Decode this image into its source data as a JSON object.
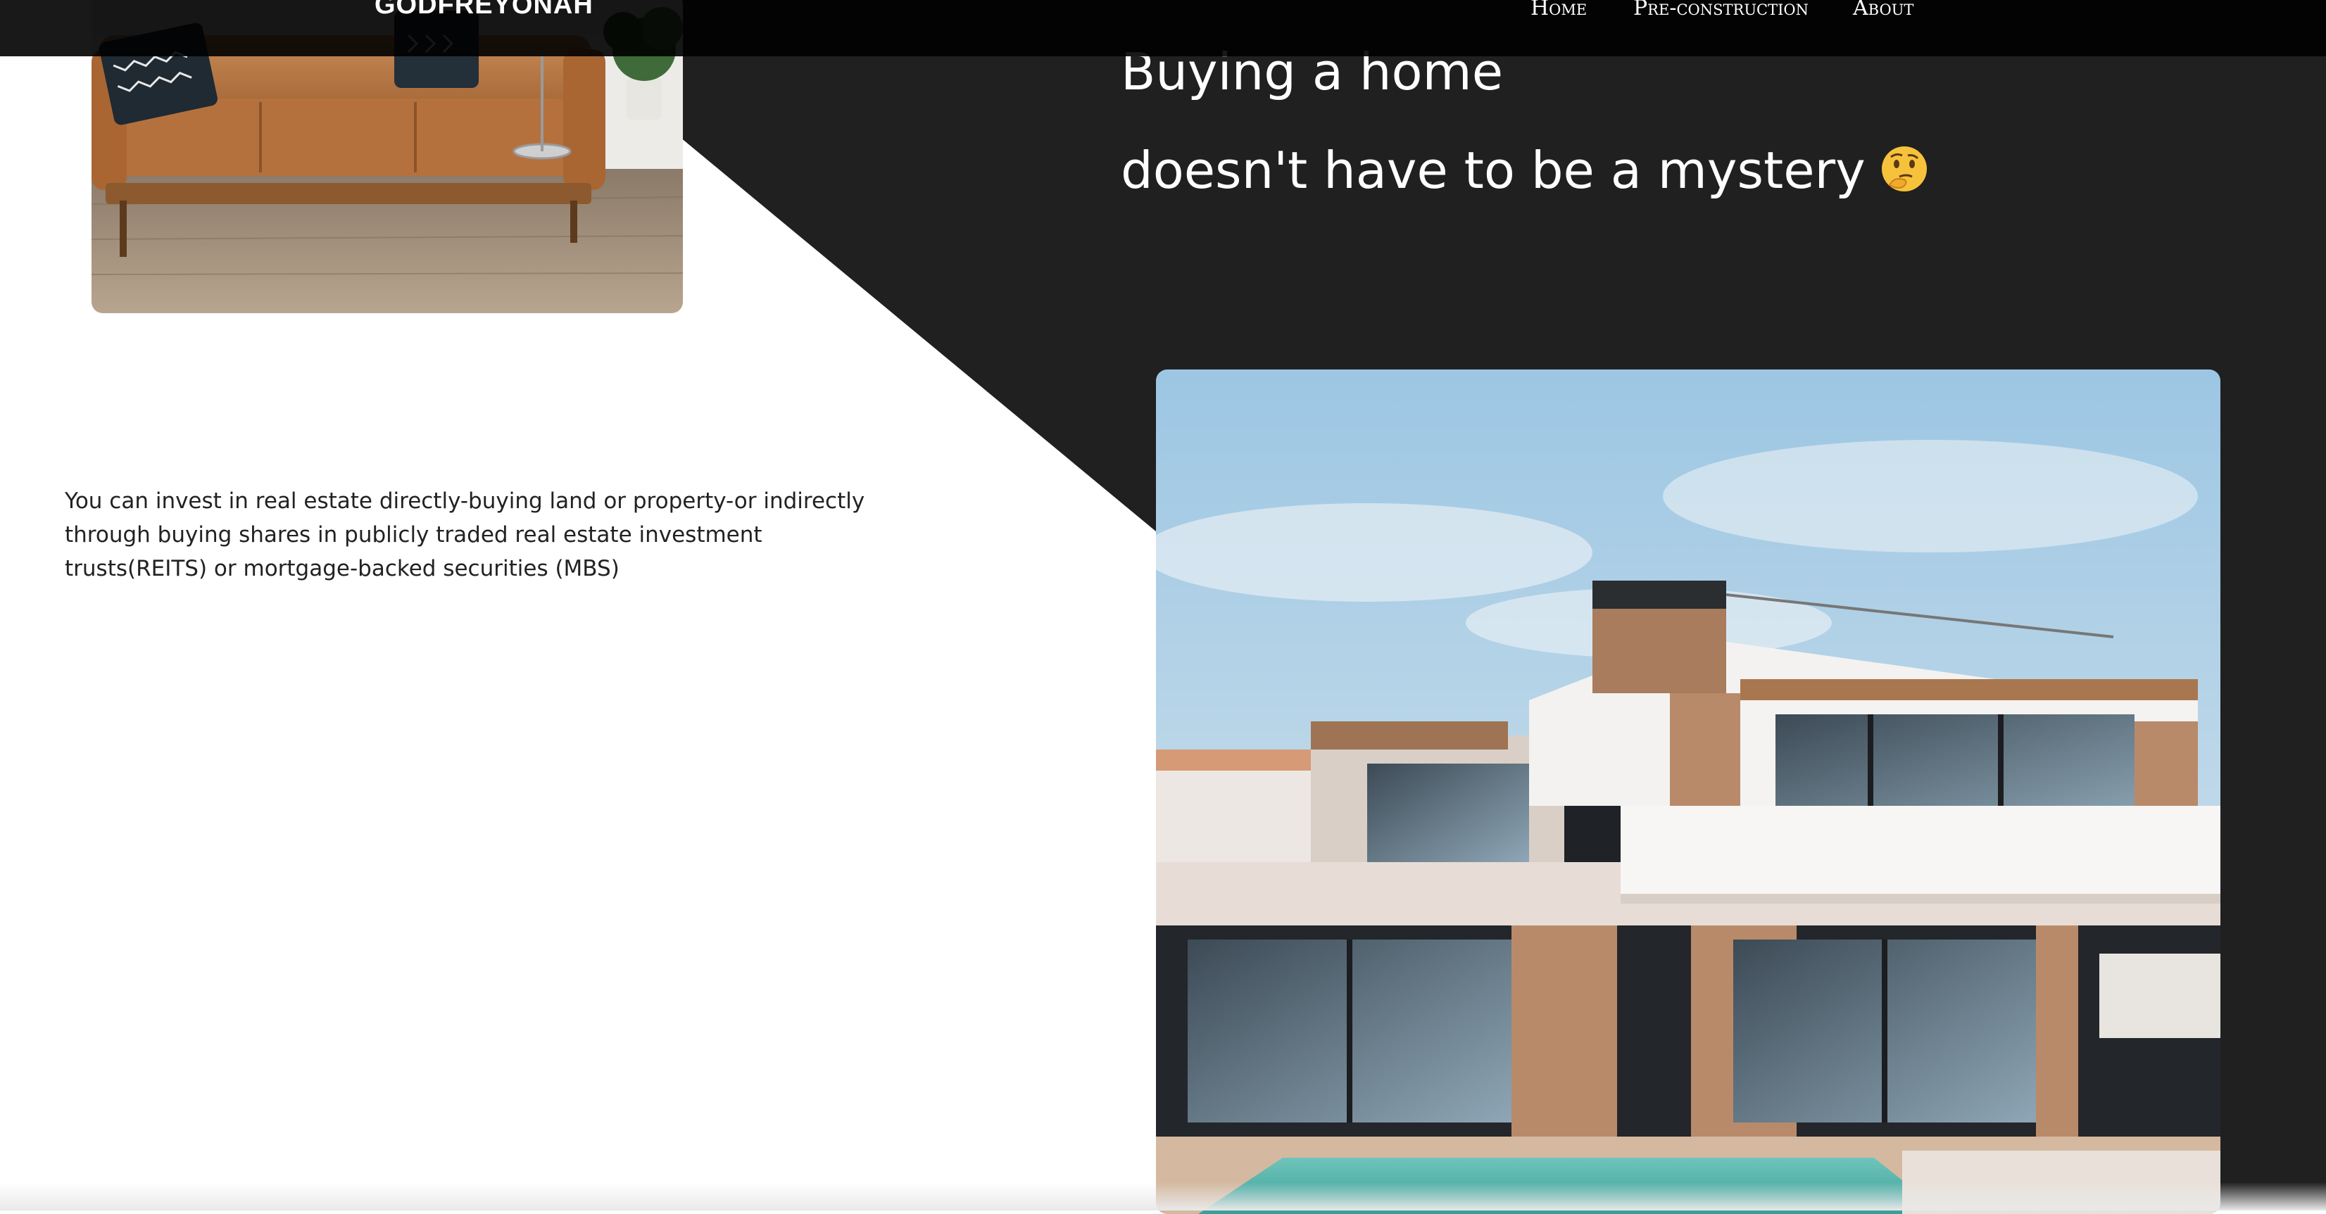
{
  "brand": "GODFREYONAH",
  "nav": [
    {
      "label": "Home"
    },
    {
      "label": "Pre-construction"
    },
    {
      "label": "About"
    }
  ],
  "hero": {
    "line1": "Buying a home",
    "line2": "doesn't have to be a mystery",
    "emoji_icon": "thinking-face-icon"
  },
  "intro": "You can invest in real estate directly-buying land or property-or indirectly through buying shares in publicly traded real estate investment trusts(REITS) or mortgage-backed securities (MBS)",
  "images": {
    "living_room": "living-room-sofa-photo",
    "house": "modern-house-pool-photo"
  },
  "colors": {
    "dark_panel": "#202020",
    "topbar": "#0c0c0c",
    "text_light": "#ffffff",
    "text_dark": "#222222"
  }
}
